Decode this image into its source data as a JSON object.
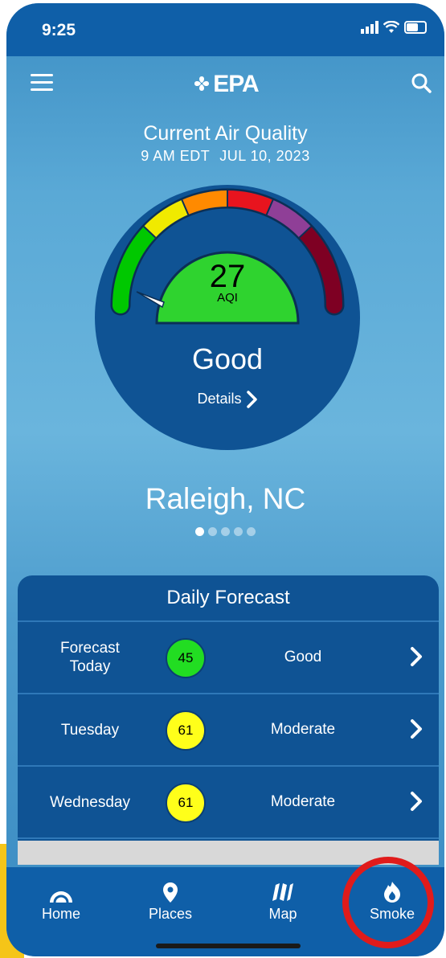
{
  "status_bar": {
    "time": "9:25"
  },
  "header": {
    "logo": "EPA"
  },
  "current": {
    "title": "Current Air Quality",
    "time": "9 AM EDT",
    "date": "JUL 10, 2023",
    "aqi_value": "27",
    "aqi_label": "AQI",
    "category": "Good",
    "details_label": "Details",
    "gauge_colors": [
      "#00c800",
      "#f0ea00",
      "#ff8a00",
      "#e8141e",
      "#8f3f97",
      "#7e0023"
    ]
  },
  "location": {
    "city": "Raleigh, NC",
    "page_count": 5,
    "active_page": 1
  },
  "forecast": {
    "title": "Daily Forecast",
    "rows": [
      {
        "day": "Forecast Today",
        "aqi": "45",
        "category": "Good",
        "color": "#22dd22"
      },
      {
        "day": "Tuesday",
        "aqi": "61",
        "category": "Moderate",
        "color": "#ffff1a"
      },
      {
        "day": "Wednesday",
        "aqi": "61",
        "category": "Moderate",
        "color": "#ffff1a"
      }
    ]
  },
  "tabs": [
    {
      "label": "Home",
      "icon": "gauge-icon"
    },
    {
      "label": "Places",
      "icon": "location-pin-icon"
    },
    {
      "label": "Map",
      "icon": "map-icon"
    },
    {
      "label": "Smoke",
      "icon": "smoke-fire-icon"
    }
  ],
  "highlight_color": "#e01b1b"
}
